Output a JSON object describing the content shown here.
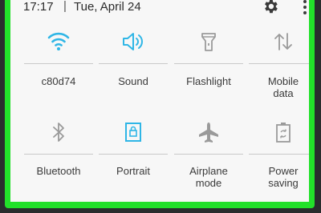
{
  "status_bar": {
    "time": "17:17",
    "separator": "|",
    "date": "Tue, April 24"
  },
  "quick_settings": {
    "row1": [
      {
        "label": "c80d74",
        "icon": "wifi-icon",
        "active": true
      },
      {
        "label": "Sound",
        "icon": "sound-icon",
        "active": true
      },
      {
        "label": "Flashlight",
        "icon": "flashlight-icon",
        "active": false
      },
      {
        "label": "Mobile\ndata",
        "icon": "mobile-data-icon",
        "active": false
      }
    ],
    "row2": [
      {
        "label": "Bluetooth",
        "icon": "bluetooth-icon",
        "active": false
      },
      {
        "label": "Portrait",
        "icon": "portrait-lock-icon",
        "active": true
      },
      {
        "label": "Airplane\nmode",
        "icon": "airplane-icon",
        "active": false
      },
      {
        "label": "Power\nsaving",
        "icon": "power-saving-icon",
        "active": false
      }
    ]
  },
  "colors": {
    "active": "#2fb6e6",
    "inactive": "#9a9a9a",
    "highlight_border": "#22e12a"
  }
}
